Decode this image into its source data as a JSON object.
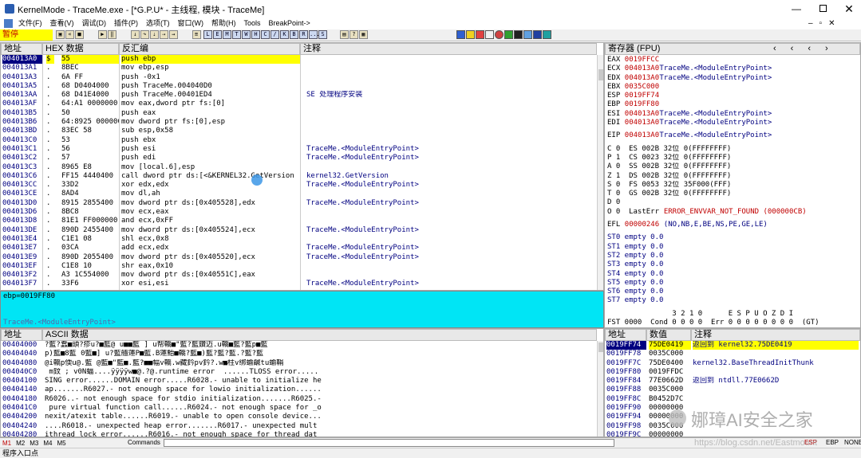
{
  "window": {
    "title": "KernelMode - TraceMe.exe - [*G.P.U* - 主线程, 模块 - TraceMe]"
  },
  "menu": [
    "文件(F)",
    "查看(V)",
    "调试(D)",
    "插件(P)",
    "选项(T)",
    "窗口(W)",
    "帮助(H)",
    "Tools",
    "BreakPoint->"
  ],
  "status": {
    "paused": "暂停"
  },
  "toolbar": {
    "letter_buttons": [
      "L",
      "E",
      "M",
      "T",
      "W",
      "H",
      "C",
      "/",
      "K",
      "B",
      "R",
      "...",
      "S"
    ]
  },
  "disasm": {
    "headers": [
      "地址",
      "HEX 数据",
      "反汇编",
      "注释"
    ],
    "rows": [
      {
        "addr": "004013A0",
        "mark": "$",
        "hex": "55",
        "asm": "push ebp",
        "comment": ""
      },
      {
        "addr": "004013A1",
        "mark": ".",
        "hex": "8BEC",
        "asm": "mov ebp,esp",
        "comment": ""
      },
      {
        "addr": "004013A3",
        "mark": ".",
        "hex": "6A FF",
        "asm": "push -0x1",
        "comment": ""
      },
      {
        "addr": "004013A5",
        "mark": ".",
        "hex": "68 D0404000",
        "asm": "push TraceMe.004040D0",
        "comment": ""
      },
      {
        "addr": "004013AA",
        "mark": ".",
        "hex": "68 D41E4000",
        "asm": "push TraceMe.00401ED4",
        "comment": "SE 处理程序安装"
      },
      {
        "addr": "004013AF",
        "mark": ".",
        "hex": "64:A1 0000000",
        "asm": "mov eax,dword ptr fs:[0]",
        "comment": ""
      },
      {
        "addr": "004013B5",
        "mark": ".",
        "hex": "50",
        "asm": "push eax",
        "comment": ""
      },
      {
        "addr": "004013B6",
        "mark": ".",
        "hex": "64:8925 000000",
        "asm": "mov dword ptr fs:[0],esp",
        "comment": ""
      },
      {
        "addr": "004013BD",
        "mark": ".",
        "hex": "83EC 58",
        "asm": "sub esp,0x58",
        "comment": ""
      },
      {
        "addr": "004013C0",
        "mark": ".",
        "hex": "53",
        "asm": "push ebx",
        "comment": ""
      },
      {
        "addr": "004013C1",
        "mark": ".",
        "hex": "56",
        "asm": "push esi",
        "comment": "TraceMe.<ModuleEntryPoint>"
      },
      {
        "addr": "004013C2",
        "mark": ".",
        "hex": "57",
        "asm": "push edi",
        "comment": "TraceMe.<ModuleEntryPoint>"
      },
      {
        "addr": "004013C3",
        "mark": ".",
        "hex": "8965 E8",
        "asm": "mov [local.6],esp",
        "comment": ""
      },
      {
        "addr": "004013C6",
        "mark": ".",
        "hex": "FF15 4440400",
        "asm": "call dword ptr ds:[<&KERNEL32.GetVersion",
        "comment": "kernel32.GetVersion"
      },
      {
        "addr": "004013CC",
        "mark": ".",
        "hex": "33D2",
        "asm": "xor edx,edx",
        "comment": "TraceMe.<ModuleEntryPoint>"
      },
      {
        "addr": "004013CE",
        "mark": ".",
        "hex": "8AD4",
        "asm": "mov dl,ah",
        "comment": ""
      },
      {
        "addr": "004013D0",
        "mark": ".",
        "hex": "8915 2855400",
        "asm": "mov dword ptr ds:[0x405528],edx",
        "comment": "TraceMe.<ModuleEntryPoint>"
      },
      {
        "addr": "004013D6",
        "mark": ".",
        "hex": "8BC8",
        "asm": "mov ecx,eax",
        "comment": ""
      },
      {
        "addr": "004013D8",
        "mark": ".",
        "hex": "81E1 FF000000",
        "asm": "and ecx,0xFF",
        "comment": ""
      },
      {
        "addr": "004013DE",
        "mark": ".",
        "hex": "890D 2455400",
        "asm": "mov dword ptr ds:[0x405524],ecx",
        "comment": "TraceMe.<ModuleEntryPoint>"
      },
      {
        "addr": "004013E4",
        "mark": ".",
        "hex": "C1E1 08",
        "asm": "shl ecx,0x8",
        "comment": ""
      },
      {
        "addr": "004013E7",
        "mark": ".",
        "hex": "03CA",
        "asm": "add ecx,edx",
        "comment": "TraceMe.<ModuleEntryPoint>"
      },
      {
        "addr": "004013E9",
        "mark": ".",
        "hex": "890D 2055400",
        "asm": "mov dword ptr ds:[0x405520],ecx",
        "comment": "TraceMe.<ModuleEntryPoint>"
      },
      {
        "addr": "004013EF",
        "mark": ".",
        "hex": "C1E8 10",
        "asm": "shr eax,0x10",
        "comment": ""
      },
      {
        "addr": "004013F2",
        "mark": ".",
        "hex": "A3 1C554000",
        "asm": "mov dword ptr ds:[0x40551C],eax",
        "comment": ""
      },
      {
        "addr": "004013F7",
        "mark": ".",
        "hex": "33F6",
        "asm": "xor esi,esi",
        "comment": "TraceMe.<ModuleEntryPoint>"
      }
    ]
  },
  "info": {
    "line1": "ebp=0019FF80",
    "line2": "TraceMe.<ModuleEntryPoint>"
  },
  "registers": {
    "header": "寄存器 (FPU)",
    "gp": [
      {
        "name": "EAX",
        "val": "0019FFCC",
        "note": ""
      },
      {
        "name": "ECX",
        "val": "004013A0",
        "note": "TraceMe.<ModuleEntryPoint>"
      },
      {
        "name": "EDX",
        "val": "004013A0",
        "note": "TraceMe.<ModuleEntryPoint>"
      },
      {
        "name": "EBX",
        "val": "0035C000",
        "note": ""
      },
      {
        "name": "ESP",
        "val": "0019FF74",
        "note": ""
      },
      {
        "name": "EBP",
        "val": "0019FF80",
        "note": ""
      },
      {
        "name": "ESI",
        "val": "004013A0",
        "note": "TraceMe.<ModuleEntryPoint>"
      },
      {
        "name": "EDI",
        "val": "004013A0",
        "note": "TraceMe.<ModuleEntryPoint>"
      }
    ],
    "eip": {
      "name": "EIP",
      "val": "004013A0",
      "note": "TraceMe.<ModuleEntryPoint>"
    },
    "flags": [
      "C 0  ES 002B 32位 0(FFFFFFFF)",
      "P 1  CS 0023 32位 0(FFFFFFFF)",
      "A 0  SS 002B 32位 0(FFFFFFFF)",
      "Z 1  DS 002B 32位 0(FFFFFFFF)",
      "S 0  FS 0053 32位 35F000(FFF)",
      "T 0  GS 002B 32位 0(FFFFFFFF)",
      "D 0"
    ],
    "lasterr": {
      "prefix": "O 0  LastErr ",
      "val": "ERROR_ENVVAR_NOT_FOUND (000000CB)"
    },
    "efl": {
      "prefix": "EFL ",
      "val": "00000246",
      "note": " (NO,NB,E,BE,NS,PE,GE,LE)"
    },
    "fpu": [
      "ST0 empty 0.0",
      "ST1 empty 0.0",
      "ST2 empty 0.0",
      "ST3 empty 0.0",
      "ST4 empty 0.0",
      "ST5 empty 0.0",
      "ST6 empty 0.0",
      "ST7 empty 0.0"
    ],
    "fpu_bits": "               3 2 1 0      E S P U O Z D I",
    "fst": "FST 0000  Cond 0 0 0 0  Err 0 0 0 0 0 0 0 0  (GT)"
  },
  "dump": {
    "headers": [
      "地址",
      "ASCII 数据"
    ],
    "rows": [
      {
        "addr": "00404000",
        "text": "?藍?蠢■頭?疹u?■藍@ u■■藍 ] u帮轎■\"藍?藍鑽迈.u轎■藍?藍p■藍"
      },
      {
        "addr": "00404040",
        "text": "p)藍■8藍 0藍■] u?藍艢蓮P■藍.B蓮鮐■轎?藍■)藍?藍?藍.?藍?藍"
      },
      {
        "addr": "00404080",
        "text": "@i轎p偄u@.藍 @藍■\"藍■.藍?■■幅v轎.w藏鈐pv鈐?.w■柱v绑蝓鹹tu蝓鞙"
      },
      {
        "addr": "004040C0",
        "text": " m鈫 ; v0N蝠....ÿÿÿÿw■@.?@.runtime error  ......TLOSS error....."
      },
      {
        "addr": "00404100",
        "text": "SING error......DOMAIN error.....R6028.- unable to initialize he"
      },
      {
        "addr": "00404140",
        "text": "ap.......R6027.- not enough space for lowio initialization......"
      },
      {
        "addr": "00404180",
        "text": "R6026..- not enough space for stdio initialization.......R6025.-"
      },
      {
        "addr": "004041C0",
        "text": " pure virtual function call......R6024.- not enough space for _o"
      },
      {
        "addr": "00404200",
        "text": "nexit/atexit table......R6019.- unable to open console device..."
      },
      {
        "addr": "00404240",
        "text": "....R6018.- unexpected heap error.......R6017.- unexpected mult"
      },
      {
        "addr": "00404280",
        "text": "ithread lock error......R6016.- not enough space for thread dat"
      }
    ]
  },
  "stack": {
    "headers": [
      "地址",
      "数值",
      "注释"
    ],
    "rows": [
      {
        "addr": "0019FF74",
        "val": "75DE0419",
        "note": "返回到 kernel32.75DE0419"
      },
      {
        "addr": "0019FF78",
        "val": "0035C000",
        "note": ""
      },
      {
        "addr": "0019FF7C",
        "val": "75DE0400",
        "note": "kernel32.BaseThreadInitThunk"
      },
      {
        "addr": "0019FF80",
        "val": "0019FFDC",
        "note": ""
      },
      {
        "addr": "0019FF84",
        "val": "77E0662D",
        "note": "返回到 ntdll.77E0662D"
      },
      {
        "addr": "0019FF88",
        "val": "0035C000",
        "note": ""
      },
      {
        "addr": "0019FF8C",
        "val": "B0452D7C",
        "note": ""
      },
      {
        "addr": "0019FF90",
        "val": "00000000",
        "note": ""
      },
      {
        "addr": "0019FF94",
        "val": "00000000",
        "note": ""
      },
      {
        "addr": "0019FF98",
        "val": "0035C000",
        "note": ""
      },
      {
        "addr": "0019FF9C",
        "val": "00000000",
        "note": ""
      }
    ]
  },
  "cmdbar": {
    "tabs": [
      "M1",
      "M2",
      "M3",
      "M4",
      "M5"
    ],
    "label": "Commands",
    "esp": "ESP",
    "ebp": "EBP",
    "none": "NONE"
  },
  "statusbar": {
    "text": "程序入口点"
  },
  "watermark": {
    "text": "娜璋AI安全之家",
    "url": "https://blog.csdn.net/Eastmount"
  }
}
